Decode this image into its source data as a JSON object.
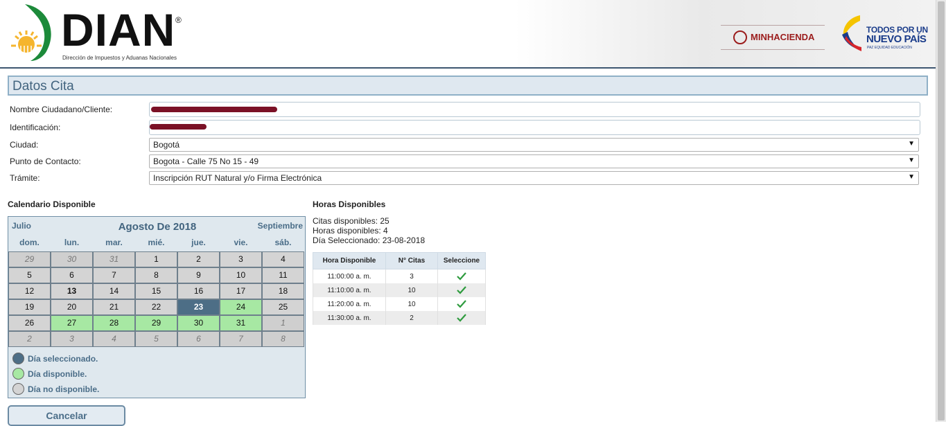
{
  "header": {
    "logo_text": "DIAN",
    "logo_reg": "®",
    "logo_subtitle": "Dirección de Impuestos y Aduanas Nacionales",
    "ministry_label": "MINHACIENDA",
    "slogan_line1": "TODOS POR UN",
    "slogan_line2": "NUEVO PAÍS",
    "slogan_line3": "PAZ   EQUIDAD   EDUCACIÓN"
  },
  "section_title": "Datos Cita",
  "form": {
    "nombre_label": "Nombre Ciudadano/Cliente:",
    "identificacion_label": "Identificación:",
    "ciudad_label": "Ciudad:",
    "ciudad_value": "Bogotá",
    "punto_label": "Punto de Contacto:",
    "punto_value": "Bogota - Calle 75 No 15 - 49",
    "tramite_label": "Trámite:",
    "tramite_value": "Inscripción RUT Natural y/o Firma Electrónica",
    "dropdown_arrow": "▼"
  },
  "calendar": {
    "heading": "Calendario Disponible",
    "prev": "Julio",
    "month": "Agosto De 2018",
    "next": "Septiembre",
    "weekdays": [
      "dom.",
      "lun.",
      "mar.",
      "mié.",
      "jue.",
      "vie.",
      "sáb."
    ],
    "weeks": [
      [
        {
          "d": "29",
          "s": "muted"
        },
        {
          "d": "30",
          "s": "muted"
        },
        {
          "d": "31",
          "s": "muted"
        },
        {
          "d": "1",
          "s": "na"
        },
        {
          "d": "2",
          "s": "na"
        },
        {
          "d": "3",
          "s": "na"
        },
        {
          "d": "4",
          "s": "na"
        }
      ],
      [
        {
          "d": "5",
          "s": "na"
        },
        {
          "d": "6",
          "s": "na"
        },
        {
          "d": "7",
          "s": "na"
        },
        {
          "d": "8",
          "s": "na"
        },
        {
          "d": "9",
          "s": "na"
        },
        {
          "d": "10",
          "s": "na"
        },
        {
          "d": "11",
          "s": "na"
        }
      ],
      [
        {
          "d": "12",
          "s": "na"
        },
        {
          "d": "13",
          "s": "na bold"
        },
        {
          "d": "14",
          "s": "na"
        },
        {
          "d": "15",
          "s": "na"
        },
        {
          "d": "16",
          "s": "na"
        },
        {
          "d": "17",
          "s": "na"
        },
        {
          "d": "18",
          "s": "na"
        }
      ],
      [
        {
          "d": "19",
          "s": "na"
        },
        {
          "d": "20",
          "s": "na"
        },
        {
          "d": "21",
          "s": "na"
        },
        {
          "d": "22",
          "s": "na"
        },
        {
          "d": "23",
          "s": "sel"
        },
        {
          "d": "24",
          "s": "avail"
        },
        {
          "d": "25",
          "s": "na"
        }
      ],
      [
        {
          "d": "26",
          "s": "na"
        },
        {
          "d": "27",
          "s": "avail"
        },
        {
          "d": "28",
          "s": "avail"
        },
        {
          "d": "29",
          "s": "avail"
        },
        {
          "d": "30",
          "s": "avail"
        },
        {
          "d": "31",
          "s": "avail"
        },
        {
          "d": "1",
          "s": "muted"
        }
      ],
      [
        {
          "d": "2",
          "s": "muted"
        },
        {
          "d": "3",
          "s": "muted"
        },
        {
          "d": "4",
          "s": "muted"
        },
        {
          "d": "5",
          "s": "muted"
        },
        {
          "d": "6",
          "s": "muted"
        },
        {
          "d": "7",
          "s": "muted"
        },
        {
          "d": "8",
          "s": "muted"
        }
      ]
    ],
    "legend": {
      "selected": "Día seleccionado.",
      "available": "Día disponible.",
      "unavailable": "Día no disponible."
    },
    "colors": {
      "selected": "#4d6e86",
      "available": "#a7e8a3",
      "unavailable": "#d4d4d4"
    }
  },
  "hours": {
    "heading": "Horas Disponibles",
    "citas_disponibles": "Citas disponibles: 25",
    "horas_disponibles": "Horas disponibles: 4",
    "dia_seleccionado": "Día Seleccionado: 23-08-2018",
    "columns": [
      "Hora Disponible",
      "N° Citas",
      "Seleccione"
    ],
    "rows": [
      {
        "hora": "11:00:00 a. m.",
        "citas": "3"
      },
      {
        "hora": "11:10:00 a. m.",
        "citas": "10"
      },
      {
        "hora": "11:20:00 a. m.",
        "citas": "10"
      },
      {
        "hora": "11:30:00 a. m.",
        "citas": "2"
      }
    ]
  },
  "cancel_label": "Cancelar"
}
